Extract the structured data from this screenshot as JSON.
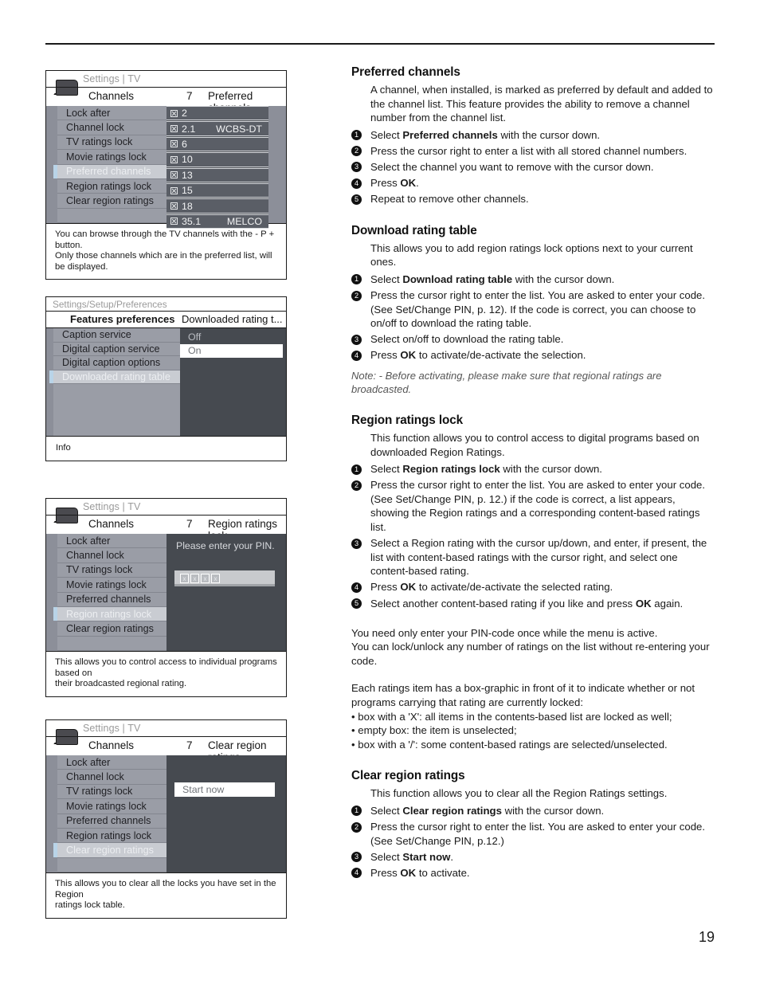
{
  "page": {
    "number": "19"
  },
  "screenshots": [
    {
      "id": "preferred-channels",
      "breadcrumb": "Settings | TV",
      "header": {
        "title": "Channels",
        "number": "7",
        "subtitle": "Preferred channels"
      },
      "menu": [
        {
          "label": "Lock after",
          "selected": false
        },
        {
          "label": "Channel lock",
          "selected": false
        },
        {
          "label": "TV ratings lock",
          "selected": false
        },
        {
          "label": "Movie ratings lock",
          "selected": false
        },
        {
          "label": "Preferred channels",
          "selected": true
        },
        {
          "label": "Region ratings lock",
          "selected": false
        },
        {
          "label": "Clear region ratings",
          "selected": false
        },
        {
          "label": "",
          "selected": false
        }
      ],
      "channels": [
        {
          "number": "2",
          "name": ""
        },
        {
          "number": "2.1",
          "name": "WCBS-DT"
        },
        {
          "number": "6",
          "name": ""
        },
        {
          "number": "10",
          "name": ""
        },
        {
          "number": "13",
          "name": ""
        },
        {
          "number": "15",
          "name": ""
        },
        {
          "number": "18",
          "name": ""
        },
        {
          "number": "35.1",
          "name": "MELCO"
        }
      ],
      "footer": [
        "You can browse through the TV channels with the - P + button.",
        "Only those channels which are in the preferred list, will be displayed."
      ]
    },
    {
      "id": "downloaded-rating-table",
      "breadcrumb": "Settings/Setup/Preferences",
      "header": {
        "title": "Features preferences",
        "subtitle": "Downloaded rating t..."
      },
      "menu": [
        {
          "label": "Caption service",
          "selected": false
        },
        {
          "label": "Digital caption service",
          "selected": false
        },
        {
          "label": "Digital caption options",
          "selected": false
        },
        {
          "label": "Downloaded rating table",
          "selected": true
        }
      ],
      "options": [
        {
          "label": "Off",
          "highlighted": false
        },
        {
          "label": "On",
          "highlighted": true
        }
      ],
      "info_label": "Info"
    },
    {
      "id": "region-ratings-lock",
      "breadcrumb": "Settings | TV",
      "header": {
        "title": "Channels",
        "number": "7",
        "subtitle": "Region ratings lock"
      },
      "menu": [
        {
          "label": "Lock after",
          "selected": false
        },
        {
          "label": "Channel lock",
          "selected": false
        },
        {
          "label": "TV ratings lock",
          "selected": false
        },
        {
          "label": "Movie ratings lock",
          "selected": false
        },
        {
          "label": "Preferred channels",
          "selected": false
        },
        {
          "label": "Region ratings lock",
          "selected": true
        },
        {
          "label": "Clear region ratings",
          "selected": false
        },
        {
          "label": "",
          "selected": false
        }
      ],
      "pin_prompt": "Please enter your PIN.",
      "pin_chars": [
        "x",
        "x",
        "x",
        "x"
      ],
      "footer": [
        "This allows you to control access to individual programs based on",
        "their broadcasted regional rating."
      ]
    },
    {
      "id": "clear-region-ratings",
      "breadcrumb": "Settings | TV",
      "header": {
        "title": "Channels",
        "number": "7",
        "subtitle": "Clear region ratings"
      },
      "menu": [
        {
          "label": "Lock after",
          "selected": false
        },
        {
          "label": "Channel lock",
          "selected": false
        },
        {
          "label": "TV ratings lock",
          "selected": false
        },
        {
          "label": "Movie ratings lock",
          "selected": false
        },
        {
          "label": "Preferred channels",
          "selected": false
        },
        {
          "label": "Region ratings lock",
          "selected": false
        },
        {
          "label": "Clear region ratings",
          "selected": true
        },
        {
          "label": "",
          "selected": false
        }
      ],
      "action_button": "Start now",
      "footer": [
        "This allows you to clear all the locks you have set in the Region",
        "ratings lock table."
      ]
    }
  ],
  "sections": [
    {
      "id": "preferred-channels",
      "heading": "Preferred channels",
      "intro": "A channel, when installed, is marked as preferred by default and added to the channel list. This feature provides the ability to remove a channel number from the channel list.",
      "steps": [
        "Select <b>Preferred channels</b> with the cursor down.",
        "Press the cursor right to enter a list with all stored channel numbers.",
        "Select the channel you want to remove with the cursor down.",
        "Press <b>OK</b>.",
        "Repeat to remove other channels."
      ]
    },
    {
      "id": "download-rating-table",
      "heading": "Download rating table",
      "intro": "This allows you to add region ratings lock options next to your current ones.",
      "steps": [
        "Select <b>Download rating table</b> with the cursor down.",
        "Press the cursor right to enter the list. You are asked to enter your code. (See Set/Change PIN, p. 12).  If the code is correct, you can choose to on/off to download the rating table.",
        "Select on/off to download the rating table.",
        "Press <b>OK</b> to activate/de-activate the selection."
      ],
      "note": "Note: - Before activating, please make sure that regional ratings are broadcasted."
    },
    {
      "id": "region-ratings-lock",
      "heading": "Region ratings lock",
      "intro": "This function allows you to control access to digital programs based on downloaded Region Ratings.",
      "steps": [
        "Select <b>Region ratings lock</b> with the cursor down.",
        "Press the cursor right to enter the list. You are asked to enter your code. (See Set/Change PIN, p. 12.) if the code is correct, a list appears, showing the Region ratings and a corresponding content-based ratings list.",
        "Select a Region rating with the cursor up/down, and enter, if present, the list with content-based ratings with the cursor right, and select one content-based rating.",
        "Press <b>OK</b> to activate/de-activate the selected rating.",
        "Select another content-based rating if you like and press <b>OK</b> again."
      ],
      "paragraphs": [
        "You need only enter your PIN-code once while the menu is active.<br>You can lock/unlock any number of ratings on the list without re-entering your code.",
        "Each ratings item has a box-graphic in front of it to indicate whether or not programs carrying that rating are currently locked:<br>&bull; box with a 'X': all items in the contents-based list are locked as well;<br>&bull; empty box: the item is unselected;<br>&bull; box with a '/': some content-based ratings are selected/unselected."
      ]
    },
    {
      "id": "clear-region-ratings",
      "heading": "Clear region ratings",
      "intro": "This function allows you to clear all the Region Ratings settings.",
      "steps": [
        "Select <b>Clear region ratings</b> with the cursor down.",
        "Press the cursor right to enter the list. You are asked to enter your code. (See Set/Change PIN, p.12.)",
        "Select <b>Start now</b>.",
        "Press <b>OK</b> to activate."
      ]
    }
  ]
}
